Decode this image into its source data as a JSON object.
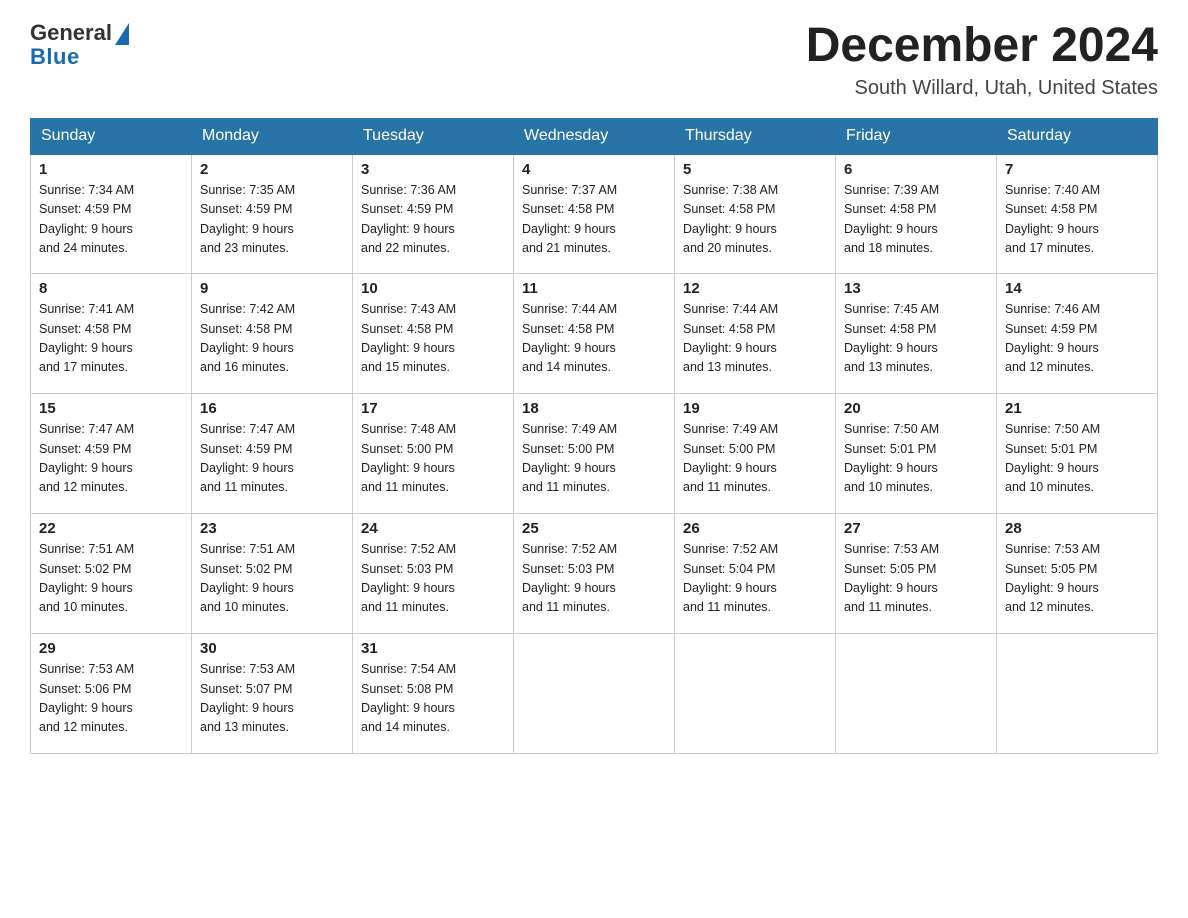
{
  "header": {
    "logo_general": "General",
    "logo_blue": "Blue",
    "month_title": "December 2024",
    "location": "South Willard, Utah, United States"
  },
  "days_of_week": [
    "Sunday",
    "Monday",
    "Tuesday",
    "Wednesday",
    "Thursday",
    "Friday",
    "Saturday"
  ],
  "weeks": [
    [
      {
        "num": "1",
        "sunrise": "7:34 AM",
        "sunset": "4:59 PM",
        "daylight": "9 hours and 24 minutes."
      },
      {
        "num": "2",
        "sunrise": "7:35 AM",
        "sunset": "4:59 PM",
        "daylight": "9 hours and 23 minutes."
      },
      {
        "num": "3",
        "sunrise": "7:36 AM",
        "sunset": "4:59 PM",
        "daylight": "9 hours and 22 minutes."
      },
      {
        "num": "4",
        "sunrise": "7:37 AM",
        "sunset": "4:58 PM",
        "daylight": "9 hours and 21 minutes."
      },
      {
        "num": "5",
        "sunrise": "7:38 AM",
        "sunset": "4:58 PM",
        "daylight": "9 hours and 20 minutes."
      },
      {
        "num": "6",
        "sunrise": "7:39 AM",
        "sunset": "4:58 PM",
        "daylight": "9 hours and 18 minutes."
      },
      {
        "num": "7",
        "sunrise": "7:40 AM",
        "sunset": "4:58 PM",
        "daylight": "9 hours and 17 minutes."
      }
    ],
    [
      {
        "num": "8",
        "sunrise": "7:41 AM",
        "sunset": "4:58 PM",
        "daylight": "9 hours and 17 minutes."
      },
      {
        "num": "9",
        "sunrise": "7:42 AM",
        "sunset": "4:58 PM",
        "daylight": "9 hours and 16 minutes."
      },
      {
        "num": "10",
        "sunrise": "7:43 AM",
        "sunset": "4:58 PM",
        "daylight": "9 hours and 15 minutes."
      },
      {
        "num": "11",
        "sunrise": "7:44 AM",
        "sunset": "4:58 PM",
        "daylight": "9 hours and 14 minutes."
      },
      {
        "num": "12",
        "sunrise": "7:44 AM",
        "sunset": "4:58 PM",
        "daylight": "9 hours and 13 minutes."
      },
      {
        "num": "13",
        "sunrise": "7:45 AM",
        "sunset": "4:58 PM",
        "daylight": "9 hours and 13 minutes."
      },
      {
        "num": "14",
        "sunrise": "7:46 AM",
        "sunset": "4:59 PM",
        "daylight": "9 hours and 12 minutes."
      }
    ],
    [
      {
        "num": "15",
        "sunrise": "7:47 AM",
        "sunset": "4:59 PM",
        "daylight": "9 hours and 12 minutes."
      },
      {
        "num": "16",
        "sunrise": "7:47 AM",
        "sunset": "4:59 PM",
        "daylight": "9 hours and 11 minutes."
      },
      {
        "num": "17",
        "sunrise": "7:48 AM",
        "sunset": "5:00 PM",
        "daylight": "9 hours and 11 minutes."
      },
      {
        "num": "18",
        "sunrise": "7:49 AM",
        "sunset": "5:00 PM",
        "daylight": "9 hours and 11 minutes."
      },
      {
        "num": "19",
        "sunrise": "7:49 AM",
        "sunset": "5:00 PM",
        "daylight": "9 hours and 11 minutes."
      },
      {
        "num": "20",
        "sunrise": "7:50 AM",
        "sunset": "5:01 PM",
        "daylight": "9 hours and 10 minutes."
      },
      {
        "num": "21",
        "sunrise": "7:50 AM",
        "sunset": "5:01 PM",
        "daylight": "9 hours and 10 minutes."
      }
    ],
    [
      {
        "num": "22",
        "sunrise": "7:51 AM",
        "sunset": "5:02 PM",
        "daylight": "9 hours and 10 minutes."
      },
      {
        "num": "23",
        "sunrise": "7:51 AM",
        "sunset": "5:02 PM",
        "daylight": "9 hours and 10 minutes."
      },
      {
        "num": "24",
        "sunrise": "7:52 AM",
        "sunset": "5:03 PM",
        "daylight": "9 hours and 11 minutes."
      },
      {
        "num": "25",
        "sunrise": "7:52 AM",
        "sunset": "5:03 PM",
        "daylight": "9 hours and 11 minutes."
      },
      {
        "num": "26",
        "sunrise": "7:52 AM",
        "sunset": "5:04 PM",
        "daylight": "9 hours and 11 minutes."
      },
      {
        "num": "27",
        "sunrise": "7:53 AM",
        "sunset": "5:05 PM",
        "daylight": "9 hours and 11 minutes."
      },
      {
        "num": "28",
        "sunrise": "7:53 AM",
        "sunset": "5:05 PM",
        "daylight": "9 hours and 12 minutes."
      }
    ],
    [
      {
        "num": "29",
        "sunrise": "7:53 AM",
        "sunset": "5:06 PM",
        "daylight": "9 hours and 12 minutes."
      },
      {
        "num": "30",
        "sunrise": "7:53 AM",
        "sunset": "5:07 PM",
        "daylight": "9 hours and 13 minutes."
      },
      {
        "num": "31",
        "sunrise": "7:54 AM",
        "sunset": "5:08 PM",
        "daylight": "9 hours and 14 minutes."
      },
      null,
      null,
      null,
      null
    ]
  ],
  "labels": {
    "sunrise": "Sunrise:",
    "sunset": "Sunset:",
    "daylight": "Daylight:"
  }
}
